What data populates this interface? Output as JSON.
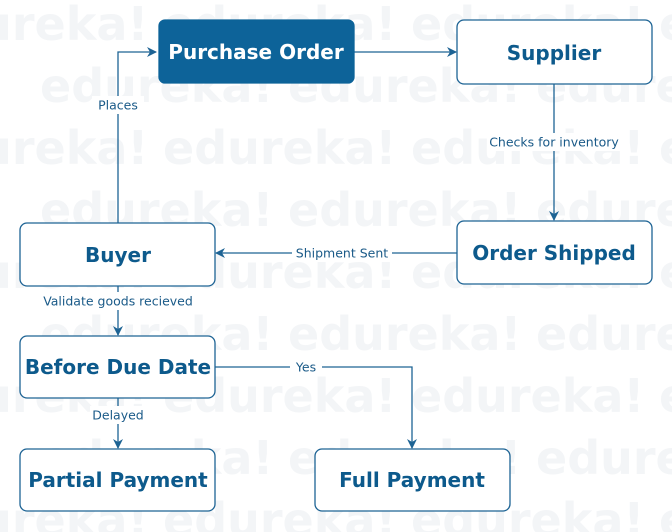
{
  "watermark": "edureka!",
  "colors": {
    "primary": "#0d6399",
    "text": "#0d5a8c",
    "edge": "#1d6394"
  },
  "nodes": {
    "purchase_order": "Purchase Order",
    "supplier": "Supplier",
    "order_shipped": "Order Shipped",
    "buyer": "Buyer",
    "before_due_date": "Before Due Date",
    "partial_payment": "Partial Payment",
    "full_payment": "Full Payment"
  },
  "edges": {
    "places": "Places",
    "checks_inventory": "Checks for inventory",
    "shipment_sent": "Shipment Sent",
    "validate_goods": "Validate goods recieved",
    "yes": "Yes",
    "delayed": "Delayed"
  }
}
